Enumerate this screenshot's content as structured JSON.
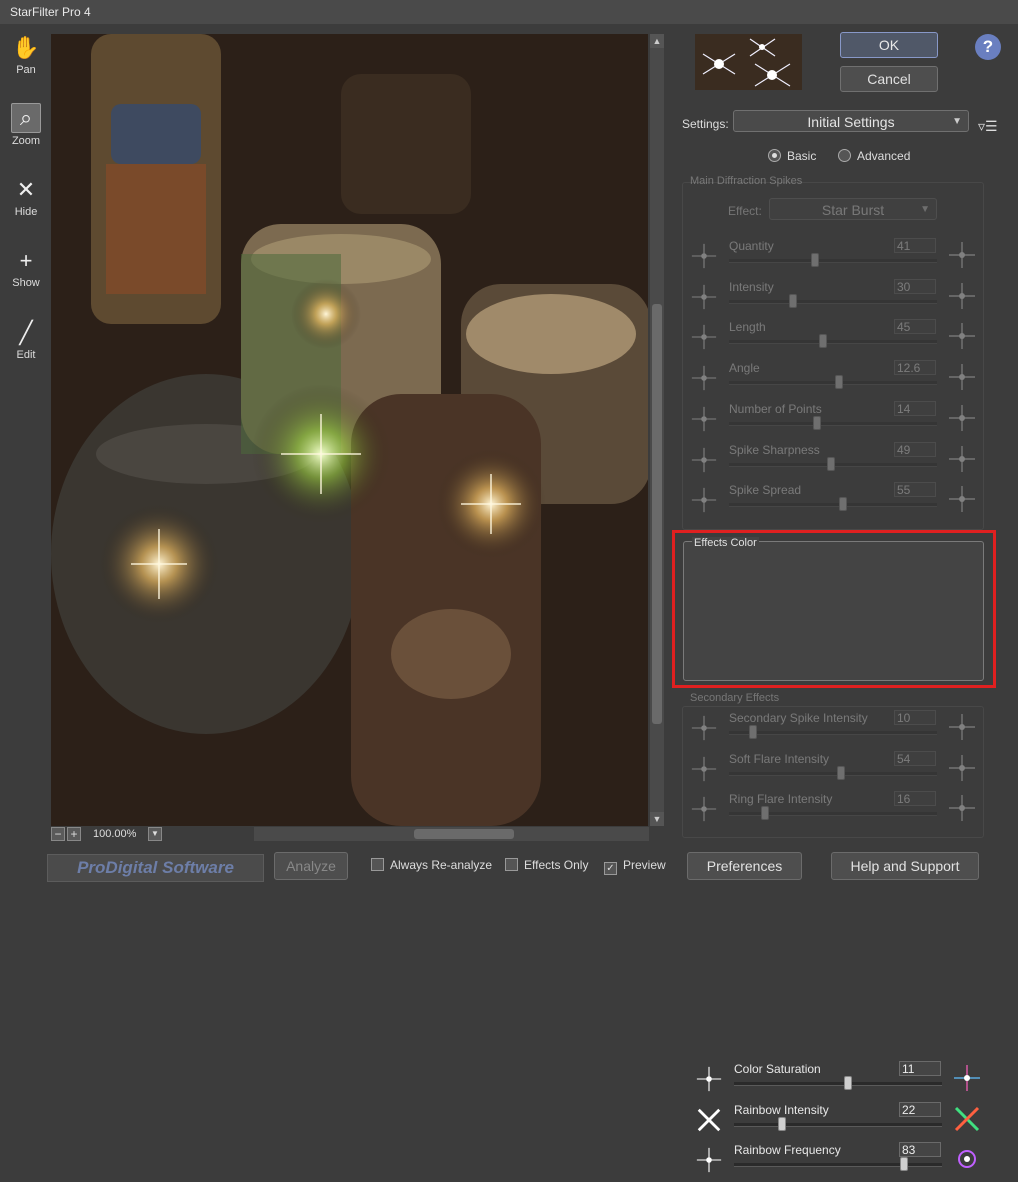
{
  "window": {
    "title": "StarFilter Pro 4"
  },
  "tools": [
    {
      "label": "Pan",
      "icon": "hand-icon",
      "glyph": "✋"
    },
    {
      "label": "Zoom",
      "icon": "magnifier-icon",
      "glyph": "🔍"
    },
    {
      "label": "Hide",
      "icon": "x-cross-icon",
      "glyph": "✕"
    },
    {
      "label": "Show",
      "icon": "plus-cross-icon",
      "glyph": "+"
    },
    {
      "label": "Edit",
      "icon": "pencil-line-icon",
      "glyph": "╱"
    }
  ],
  "zoom": {
    "value": "100.00%",
    "minus": "−",
    "plus": "+",
    "dropdown": "▼"
  },
  "buttons": {
    "ok": "OK",
    "cancel": "Cancel",
    "help": "?",
    "preferences": "Preferences",
    "help_support": "Help and Support",
    "analyze": "Analyze"
  },
  "logo": {
    "text": "ProDigital Software"
  },
  "checkboxes": {
    "always_reanalyze": {
      "label": "Always Re-analyze",
      "checked": false
    },
    "effects_only": {
      "label": "Effects Only",
      "checked": false
    },
    "preview": {
      "label": "Preview",
      "checked": true
    }
  },
  "settings": {
    "label": "Settings:",
    "value": "Initial Settings"
  },
  "mode": {
    "basic": "Basic",
    "advanced": "Advanced",
    "selected": "Basic"
  },
  "main_spikes": {
    "title": "Main Diffraction Spikes",
    "effect_label": "Effect:",
    "effect_value": "Star Burst",
    "sliders": [
      {
        "label": "Quantity",
        "value": "41",
        "fraction": 0.41
      },
      {
        "label": "Intensity",
        "value": "30",
        "fraction": 0.3
      },
      {
        "label": "Length",
        "value": "45",
        "fraction": 0.45
      },
      {
        "label": "Angle",
        "value": "12.6",
        "fraction": 0.53
      },
      {
        "label": "Number of Points",
        "value": "14",
        "fraction": 0.42
      },
      {
        "label": "Spike Sharpness",
        "value": "49",
        "fraction": 0.49
      },
      {
        "label": "Spike Spread",
        "value": "55",
        "fraction": 0.55
      }
    ]
  },
  "effects_color": {
    "title": "Effects Color",
    "sliders": [
      {
        "label": "Color Saturation",
        "value": "11",
        "fraction": 0.55
      },
      {
        "label": "Rainbow Intensity",
        "value": "22",
        "fraction": 0.22
      },
      {
        "label": "Rainbow Frequency",
        "value": "83",
        "fraction": 0.83
      }
    ]
  },
  "secondary": {
    "title": "Secondary Effects",
    "sliders": [
      {
        "label": "Secondary Spike Intensity",
        "value": "10",
        "fraction": 0.1
      },
      {
        "label": "Soft Flare Intensity",
        "value": "54",
        "fraction": 0.54
      },
      {
        "label": "Ring Flare Intensity",
        "value": "16",
        "fraction": 0.16
      }
    ]
  },
  "colors": {
    "highlight": "#e02020",
    "accent": "#6a7fc0"
  }
}
